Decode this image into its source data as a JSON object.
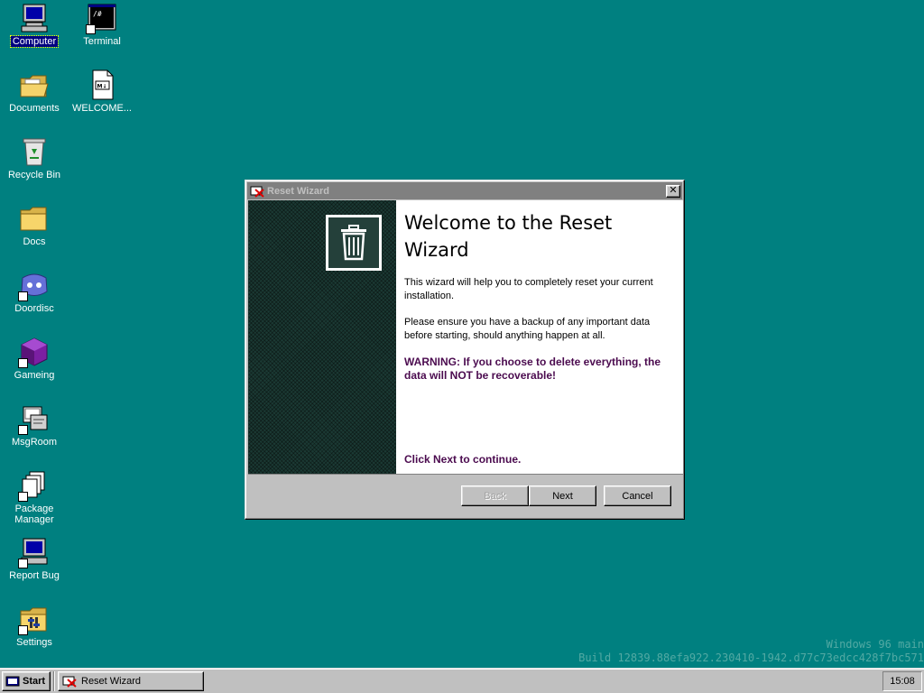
{
  "desktop": {
    "icons": [
      {
        "id": "computer",
        "label": "Computer"
      },
      {
        "id": "terminal",
        "label": "Terminal"
      },
      {
        "id": "documents",
        "label": "Documents"
      },
      {
        "id": "welcome",
        "label": "WELCOME..."
      },
      {
        "id": "recycle",
        "label": "Recycle Bin"
      },
      {
        "id": "docs",
        "label": "Docs"
      },
      {
        "id": "doordisc",
        "label": "Doordisc"
      },
      {
        "id": "gameing",
        "label": "Gameing"
      },
      {
        "id": "msgroom",
        "label": "MsgRoom"
      },
      {
        "id": "pkgmgr",
        "label": "Package Manager"
      },
      {
        "id": "reportbug",
        "label": "Report Bug"
      },
      {
        "id": "settings",
        "label": "Settings"
      }
    ],
    "terminal_glyph": "/#",
    "welcome_glyph": "M↓"
  },
  "wizard": {
    "title": "Reset Wizard",
    "heading": "Welcome to the Reset Wizard",
    "para1": "This wizard will help you to completely reset your current installation.",
    "para2": "Please ensure you have a backup of any important data before starting, should anything happen at all.",
    "warning": "WARNING: If you choose to delete everything, the data will NOT be recoverable!",
    "continue": "Click Next to continue.",
    "close_glyph": "✕",
    "buttons": {
      "back": "Back",
      "next": "Next",
      "cancel": "Cancel"
    },
    "accent": "#4b0b4f"
  },
  "watermark": {
    "line1": "Windows 96 main",
    "line2": "Build 12839.88efa922.230410-1942.d77c73edcc428f7bc571"
  },
  "taskbar": {
    "start": "Start",
    "task": "Reset Wizard",
    "clock": "15:08"
  },
  "colors": {
    "desktop": "#008080",
    "titlebar_inactive": "#808080"
  }
}
